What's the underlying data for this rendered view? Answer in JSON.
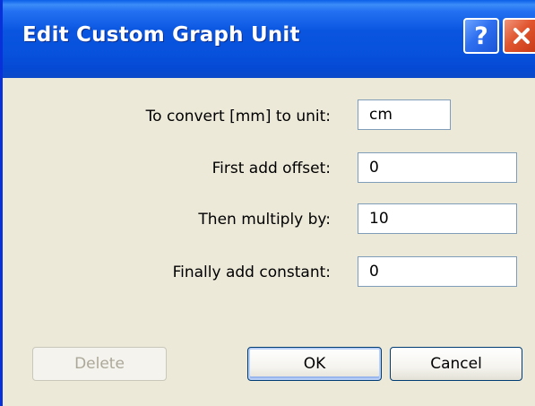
{
  "window": {
    "title": "Edit Custom Graph Unit",
    "help_label": "?",
    "close_label": "close"
  },
  "form": {
    "fields": [
      {
        "label": "To convert [mm] to unit:",
        "value": "cm"
      },
      {
        "label": "First add offset:",
        "value": "0"
      },
      {
        "label": "Then multiply by:",
        "value": "10"
      },
      {
        "label": "Finally add constant:",
        "value": "0"
      }
    ]
  },
  "buttons": {
    "delete_label": "Delete",
    "delete_enabled": false,
    "ok_label": "OK",
    "cancel_label": "Cancel"
  },
  "colors": {
    "titlebar": "#0a55e0",
    "dialog_bg": "#ece9d8",
    "close_button": "#e0542e",
    "input_border": "#7f9db9"
  },
  "icons": {
    "help": "question-mark-icon",
    "close": "x-close-icon"
  }
}
